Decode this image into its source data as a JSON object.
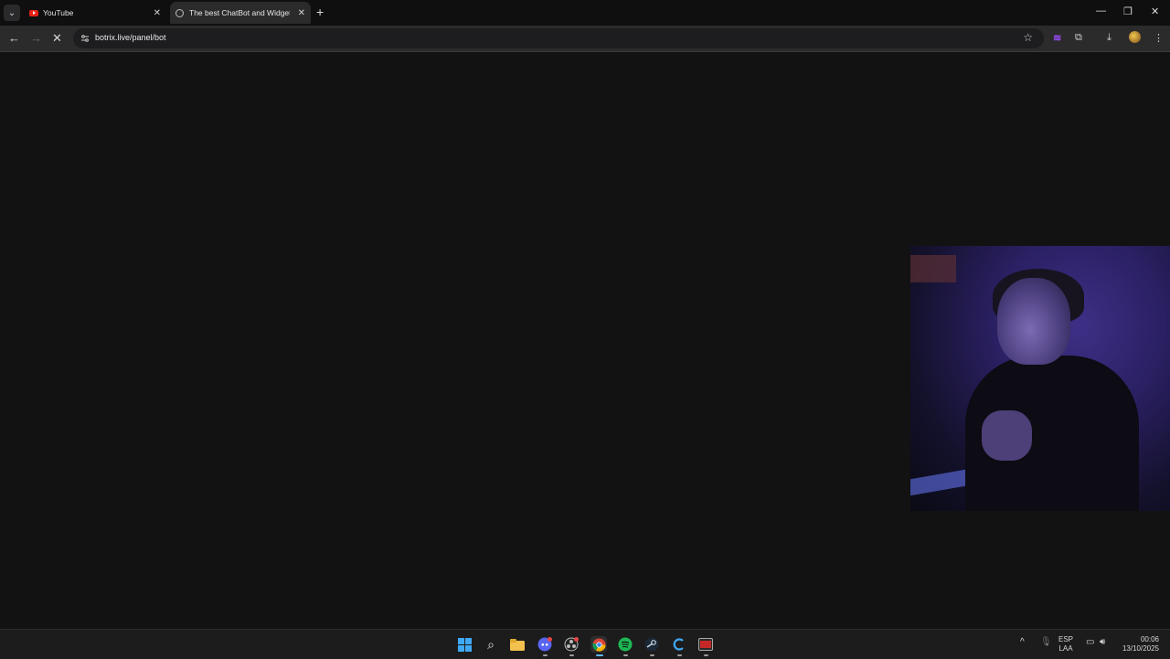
{
  "browser": {
    "tabs": [
      {
        "title": "YouTube",
        "active": false
      },
      {
        "title": "The best ChatBot and Widgets",
        "active": true
      }
    ],
    "url": "botrix.live/panel/bot"
  },
  "taskbar": {
    "language": "ESP",
    "layout": "LAA",
    "time": "00:06",
    "date": "13/10/2025"
  },
  "colors": {
    "page_background": "#121212",
    "windows_blue": "#3fa9f5",
    "youtube_red": "#e62117"
  }
}
